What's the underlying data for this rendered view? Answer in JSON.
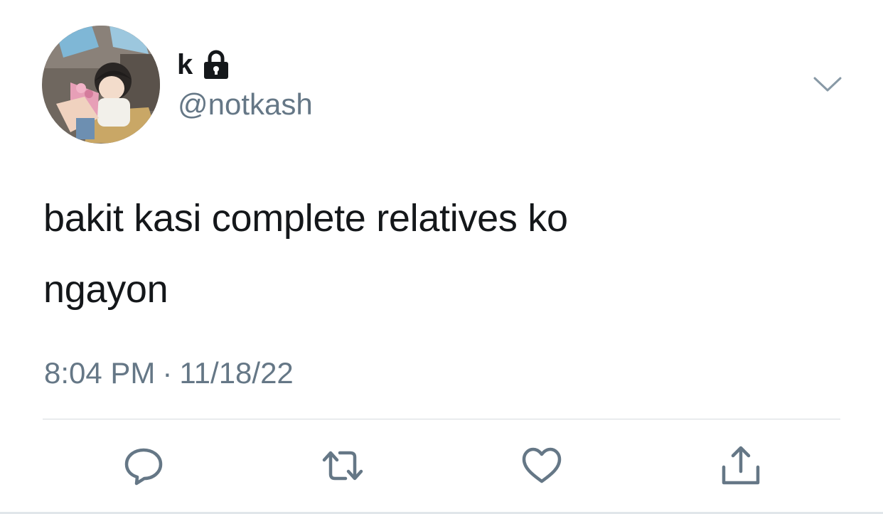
{
  "tweet": {
    "display_name": "k",
    "handle": "@notkash",
    "text_line1": "bakit kasi complete relatives ko",
    "text_line2": "ngayon",
    "time": "8:04 PM",
    "separator": "·",
    "date": "11/18/22"
  },
  "icons": {
    "lock": "lock-icon",
    "menu": "chevron-down-icon",
    "reply": "reply-icon",
    "retweet": "retweet-icon",
    "like": "heart-icon",
    "share": "share-icon"
  },
  "colors": {
    "text": "#14171a",
    "secondary": "#657786",
    "divider": "#d6dbdf"
  }
}
